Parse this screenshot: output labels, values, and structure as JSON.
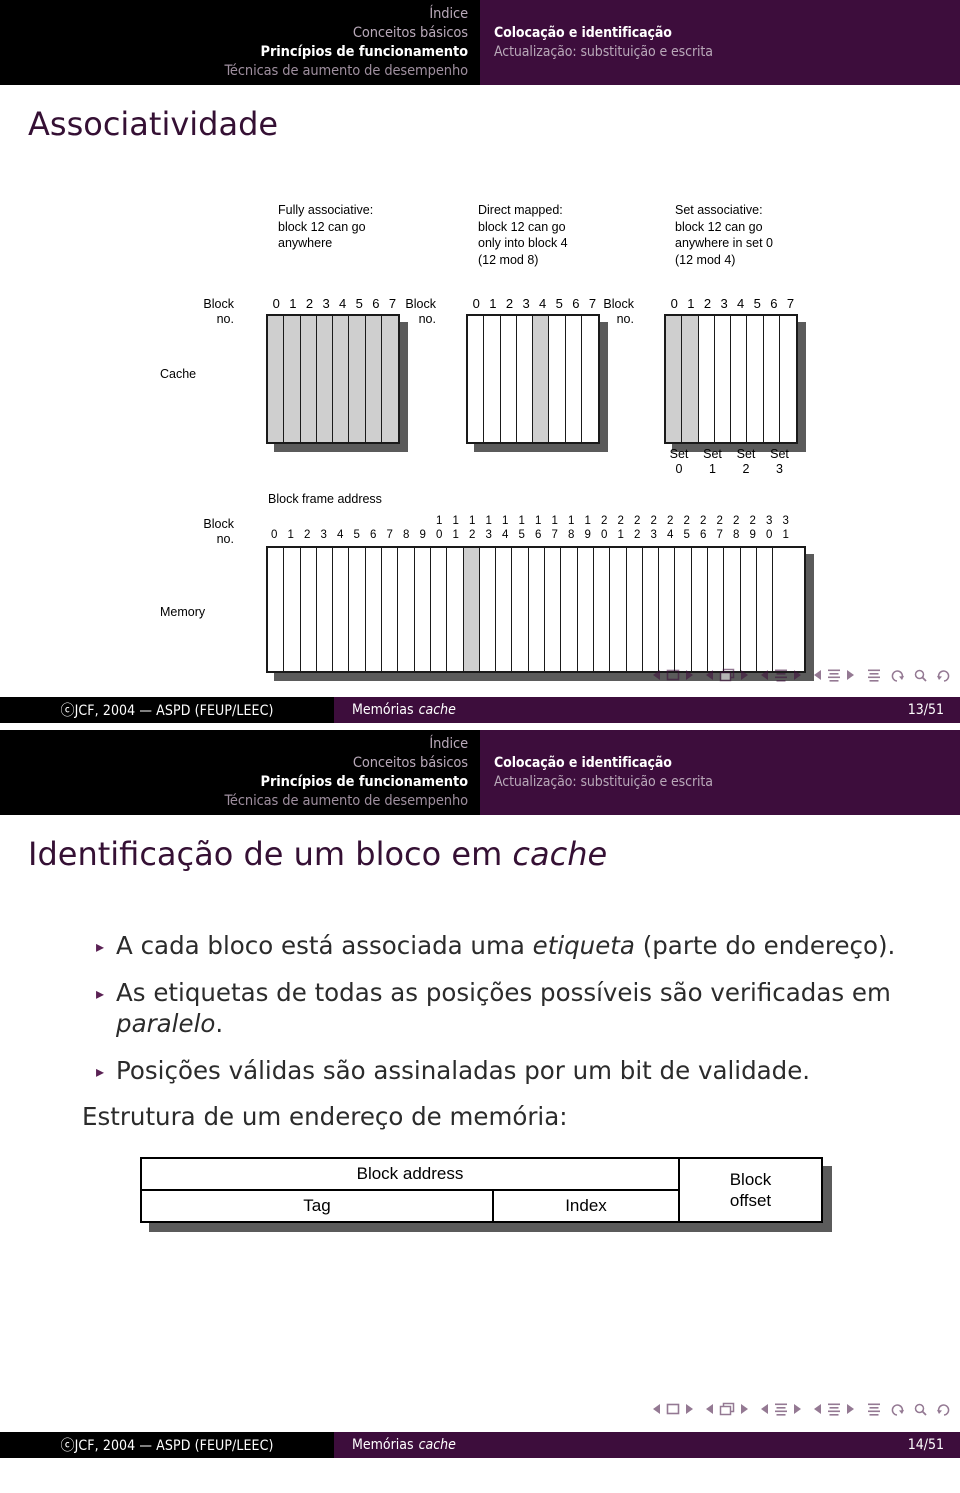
{
  "colors": {
    "header_black": "#000000",
    "header_purple": "#3d0d3c",
    "title_purple": "#351034",
    "bullet_marker": "#5a2154",
    "cell_highlight": "#cfcfcf",
    "shadow_gray": "#5b5b5b"
  },
  "header": {
    "left_items": [
      {
        "label": "Índice",
        "active": false
      },
      {
        "label": "Conceitos básicos",
        "active": false
      },
      {
        "label": "Princípios de funcionamento",
        "active": true
      },
      {
        "label": "Técnicas de aumento de desempenho",
        "active": false
      }
    ],
    "right_items": [
      {
        "label": "Colocação e identificação",
        "active": true
      },
      {
        "label": "Actualização: substituição e escrita",
        "active": false
      }
    ]
  },
  "slide1": {
    "title": "Associatividade",
    "columns": [
      {
        "caption": "Fully associative:\nblock 12 can go\nanywhere",
        "block_label_line1": "Block",
        "block_label_line2": "no.",
        "digits": [
          "0",
          "1",
          "2",
          "3",
          "4",
          "5",
          "6",
          "7"
        ],
        "highlight": [
          0,
          1,
          2,
          3,
          4,
          5,
          6,
          7
        ]
      },
      {
        "caption": "Direct mapped:\nblock 12 can go\nonly into block 4\n(12 mod 8)",
        "block_label_line1": "Block",
        "block_label_line2": "no.",
        "digits": [
          "0",
          "1",
          "2",
          "3",
          "4",
          "5",
          "6",
          "7"
        ],
        "highlight": [
          4
        ]
      },
      {
        "caption": "Set associative:\nblock 12 can go\nanywhere in set 0\n(12 mod 4)",
        "block_label_line1": "Block",
        "block_label_line2": "no.",
        "digits": [
          "0",
          "1",
          "2",
          "3",
          "4",
          "5",
          "6",
          "7"
        ],
        "highlight": [
          0,
          1
        ]
      }
    ],
    "cache_label": "Cache",
    "memory_label": "Memory",
    "set_labels": [
      {
        "word": "Set",
        "num": "0"
      },
      {
        "word": "Set",
        "num": "1"
      },
      {
        "word": "Set",
        "num": "2"
      },
      {
        "word": "Set",
        "num": "3"
      }
    ],
    "block_frame_address_label": "Block frame address",
    "memory_block_label_line1": "Block",
    "memory_block_label_line2": "no.",
    "memory_digits_tens": [
      "",
      "",
      "",
      "",
      "",
      "",
      "",
      "",
      "",
      "",
      "1",
      "1",
      "1",
      "1",
      "1",
      "1",
      "1",
      "1",
      "1",
      "1",
      "2",
      "2",
      "2",
      "2",
      "2",
      "2",
      "2",
      "2",
      "2",
      "2",
      "3",
      "3"
    ],
    "memory_digits_ones": [
      "0",
      "1",
      "2",
      "3",
      "4",
      "5",
      "6",
      "7",
      "8",
      "9",
      "0",
      "1",
      "2",
      "3",
      "4",
      "5",
      "6",
      "7",
      "8",
      "9",
      "0",
      "1",
      "2",
      "3",
      "4",
      "5",
      "6",
      "7",
      "8",
      "9",
      "0",
      "1"
    ],
    "memory_highlight": [
      12
    ],
    "footer": {
      "copyright": "ⓒJCF, 2004 — ASPD (FEUP/LEEC)",
      "section": "Memórias",
      "section_italic": "cache",
      "page": "13/51"
    }
  },
  "slide2": {
    "title": "Identificação de um bloco em ",
    "title_italic": "cache",
    "bullets": [
      {
        "marker": "▸",
        "pre": "A cada bloco está associada uma ",
        "italic": "etiqueta",
        "post": " (parte do endereço)."
      },
      {
        "marker": "▸",
        "pre": "As etiquetas de todas as posições possíveis são verificadas em ",
        "italic": "paralelo",
        "post": "."
      },
      {
        "marker": "▸",
        "pre": "Posições válidas são assinaladas por um bit de validade.",
        "italic": "",
        "post": ""
      }
    ],
    "structure_line": "Estrutura de um endereço de memória:",
    "address_diagram": {
      "block_address": "Block address",
      "tag": "Tag",
      "index": "Index",
      "block_offset_line1": "Block",
      "block_offset_line2": "offset"
    },
    "footer": {
      "copyright": "ⓒJCF, 2004 — ASPD (FEUP/LEEC)",
      "section": "Memórias",
      "section_italic": "cache",
      "page": "14/51"
    }
  },
  "navigation": {
    "groups": [
      {
        "name": "slide-nav",
        "icon": "square-icon"
      },
      {
        "name": "frame-nav",
        "icon": "stacked-squares-icon"
      },
      {
        "name": "subsection-nav",
        "icon": "lines-icon"
      },
      {
        "name": "section-nav",
        "icon": "lines-icon"
      }
    ],
    "solo": [
      {
        "name": "presentation-nav",
        "icon": "lines-icon"
      },
      {
        "name": "back-icon",
        "icon": "undo-arrow-icon"
      },
      {
        "name": "search-icon",
        "icon": "magnifier-icon"
      },
      {
        "name": "forward-icon",
        "icon": "redo-arrow-icon"
      }
    ]
  }
}
